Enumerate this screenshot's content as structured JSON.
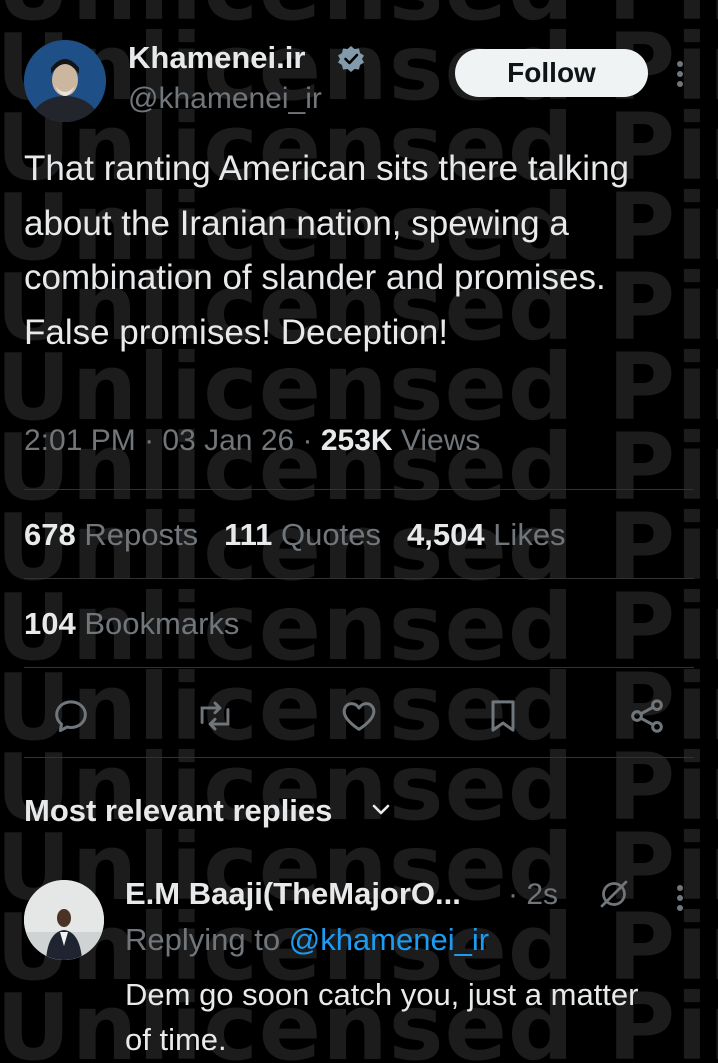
{
  "watermark": {
    "lines": [
      "Unlicensed Pintura insta",
      "Unlicensed Pintura insta",
      "Unlicensed Pintura insta",
      "Unlicensed Pintura insta",
      "Unlicensed Pintura insta",
      "Unlicensed Pintura insta",
      "Unlicensed Pintura insta",
      "Unlicensed Pintura insta",
      "Unlicensed Pintura insta",
      "Unlicensed Pintura insta",
      "Unlicensed Pintura insta",
      "Unlicensed Pintura insta",
      "Unlicensed Pintura insta",
      "Unlicensed Pintura insta"
    ]
  },
  "post": {
    "author_name": "Khamenei.ir",
    "author_handle": "@khamenei_ir",
    "verified": true,
    "follow_label": "Follow",
    "text": "That ranting American sits there talking about the Iranian nation, spewing a combination of slander and promises. False promises! Deception!",
    "time": "2:01 PM",
    "date": "03 Jan 26",
    "views_count": "253K",
    "views_label": "Views",
    "reposts_count": "678",
    "reposts_label": "Reposts",
    "quotes_count": "111",
    "quotes_label": "Quotes",
    "likes_count": "4,504",
    "likes_label": "Likes",
    "bookmarks_count": "104",
    "bookmarks_label": "Bookmarks"
  },
  "actions": [
    "reply-icon",
    "repost-icon",
    "like-icon",
    "bookmark-icon",
    "share-icon"
  ],
  "replies": {
    "heading": "Most relevant replies",
    "items": [
      {
        "name": "E.M Baaji(TheMajorO...",
        "time": "2s",
        "replying_prefix": "Replying to",
        "replying_to": "@khamenei_ir",
        "text": "Dem go soon catch you, just a matter of time."
      }
    ]
  },
  "colors": {
    "background": "#000000",
    "text_primary": "#e7e9ea",
    "text_secondary": "#71767b",
    "accent": "#1d9bf0",
    "divider": "#2f3336"
  }
}
